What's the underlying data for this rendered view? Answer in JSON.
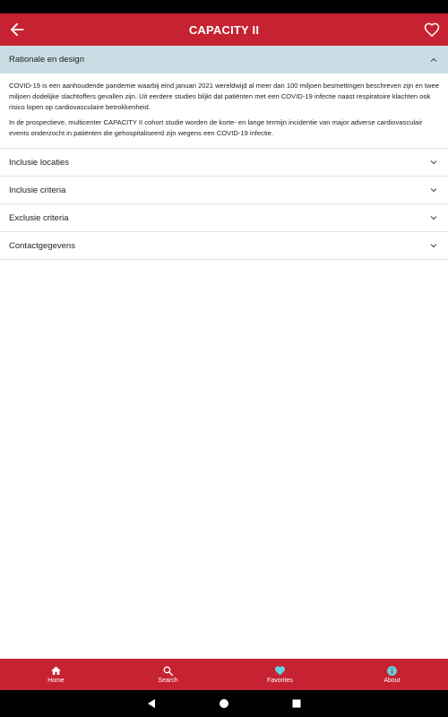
{
  "app_bar": {
    "title": "CAPACITY II",
    "back_icon": "arrow-left-icon",
    "favorite_icon": "heart-outline-icon"
  },
  "accordion": [
    {
      "label": "Rationale en design",
      "expanded": true,
      "paragraphs": [
        "COVID-19 is een aanhoudende pandemie waarbij eind januari 2021 wereldwijd al meer dan 100 miljoen besmettingen beschreven zijn en twee miljoen dodelijke slachtoffers gevallen zijn. Uit eerdere studies blijkt dat patiënten met een COVID-19 infectie naast respiratoire klachten ook risico lopen op cardiovasculaire betrokkenheid.",
        "In de prospectieve, multicenter CAPACITY II cohort studie worden de korte- en lange termijn incidentie van major adverse cardiovasculair events onderzocht in patiënten die gehospitaliseerd zijn wegens een COVID-19 infectie."
      ]
    },
    {
      "label": "Inclusie locaties",
      "expanded": false
    },
    {
      "label": "Inclusie criteria",
      "expanded": false
    },
    {
      "label": "Exclusie criteria",
      "expanded": false
    },
    {
      "label": "Contactgegevens",
      "expanded": false
    }
  ],
  "bottom_nav": [
    {
      "label": "Home",
      "icon": "home-icon"
    },
    {
      "label": "Search",
      "icon": "search-icon"
    },
    {
      "label": "Favorites",
      "icon": "heart-icon"
    },
    {
      "label": "About",
      "icon": "info-icon"
    }
  ],
  "colors": {
    "brand": "#c62231",
    "expanded_header": "#c8dde3",
    "favorites_icon": "#5fd3e0"
  }
}
